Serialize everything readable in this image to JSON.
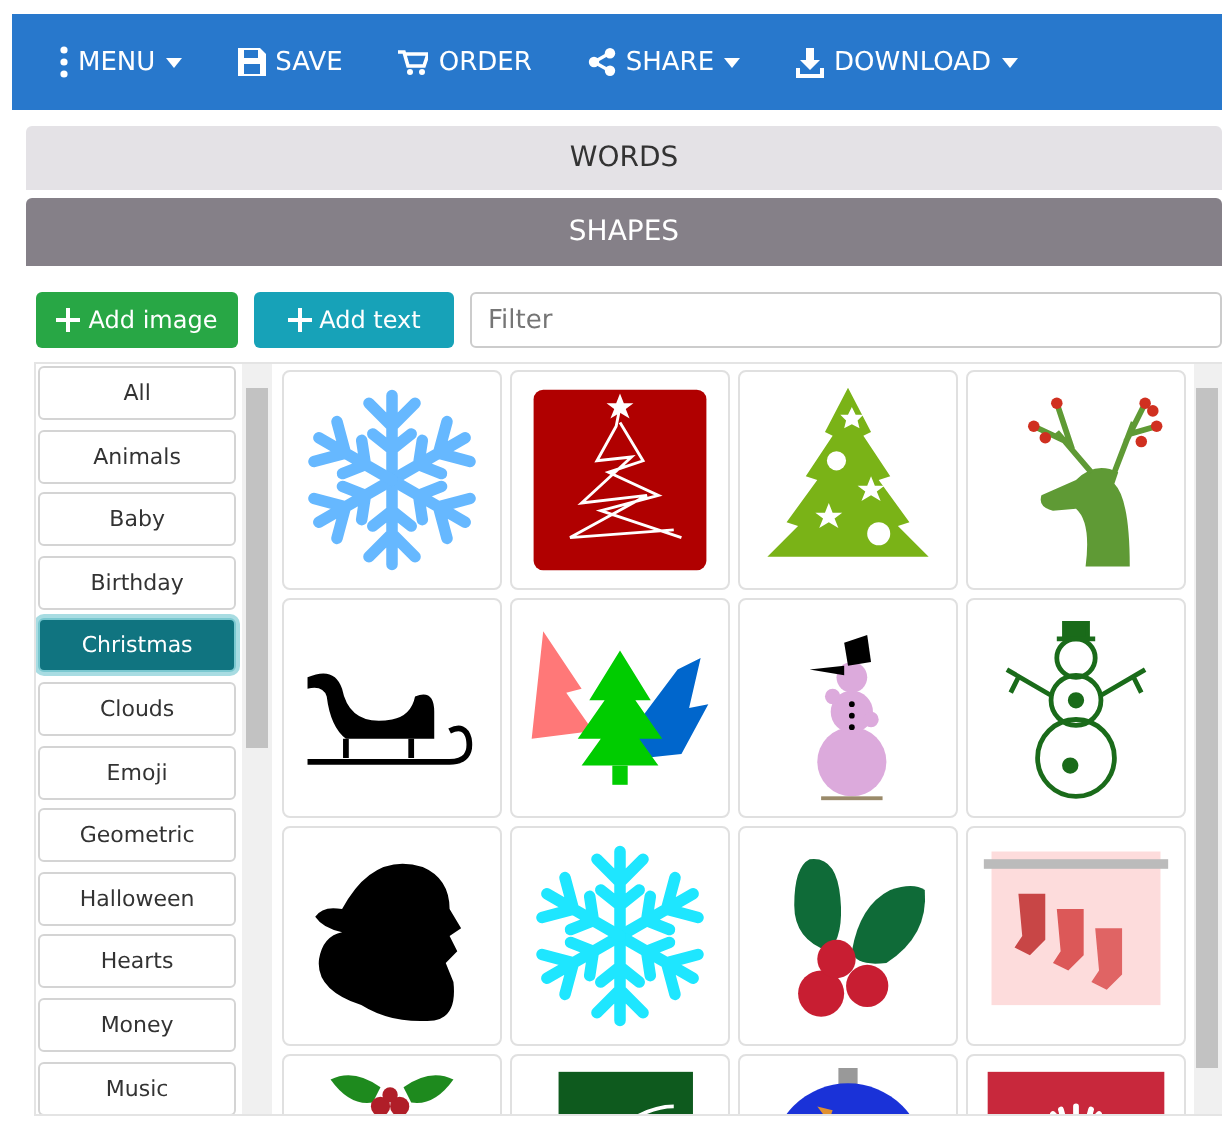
{
  "toolbar": [
    {
      "kind": "menu",
      "label": "MENU",
      "dropdown": true
    },
    {
      "kind": "save",
      "label": "SAVE",
      "dropdown": false
    },
    {
      "kind": "order",
      "label": "ORDER",
      "dropdown": false
    },
    {
      "kind": "share",
      "label": "SHARE",
      "dropdown": true
    },
    {
      "kind": "download",
      "label": "DOWNLOAD",
      "dropdown": true
    }
  ],
  "sections": [
    {
      "label": "WORDS",
      "selected": false
    },
    {
      "label": "SHAPES",
      "selected": true
    }
  ],
  "actions": [
    {
      "kind": "image",
      "label": "Add image"
    },
    {
      "kind": "text",
      "label": "Add text"
    }
  ],
  "filter": {
    "placeholder": "Filter"
  },
  "categories": [
    {
      "label": "All",
      "selected": false
    },
    {
      "label": "Animals",
      "selected": false
    },
    {
      "label": "Baby",
      "selected": false
    },
    {
      "label": "Birthday",
      "selected": false
    },
    {
      "label": "Christmas",
      "selected": true
    },
    {
      "label": "Clouds",
      "selected": false
    },
    {
      "label": "Emoji",
      "selected": false
    },
    {
      "label": "Geometric",
      "selected": false
    },
    {
      "label": "Halloween",
      "selected": false
    },
    {
      "label": "Hearts",
      "selected": false
    },
    {
      "label": "Money",
      "selected": false
    },
    {
      "label": "Music",
      "selected": false
    }
  ],
  "tiles": [
    {
      "kind": "snowflake",
      "color": "#66b8ff"
    },
    {
      "kind": "treecard",
      "color": "#b00000"
    },
    {
      "kind": "startree",
      "color": "#7ab317"
    },
    {
      "kind": "reindeer",
      "color": "#5f9a35"
    },
    {
      "kind": "sleigh",
      "color": "#000000"
    },
    {
      "kind": "forest",
      "color": "#00cc00"
    },
    {
      "kind": "snowman",
      "color": "#dcaadc"
    },
    {
      "kind": "outlinesnowman",
      "color": "#1a6b1a"
    },
    {
      "kind": "santa",
      "color": "#000000"
    },
    {
      "kind": "snowflake",
      "color": "#1ee6ff"
    },
    {
      "kind": "holly",
      "color": "#0f6b38"
    },
    {
      "kind": "stockings",
      "color": "#fddcdc"
    },
    {
      "kind": "sprig",
      "color": "#1e8a1e"
    },
    {
      "kind": "greencard",
      "color": "#0e5a1e"
    },
    {
      "kind": "ornament",
      "color": "#1a32d8"
    },
    {
      "kind": "redcard",
      "color": "#c8283c"
    }
  ]
}
